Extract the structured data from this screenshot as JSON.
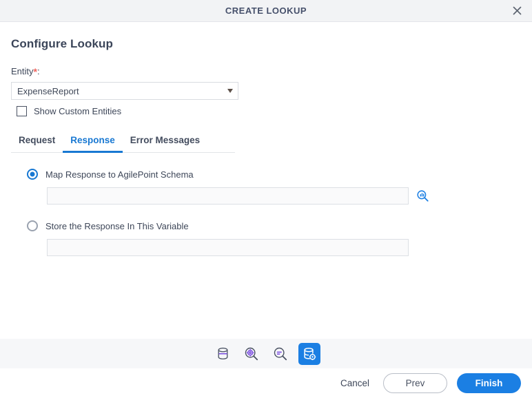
{
  "window": {
    "title": "CREATE LOOKUP",
    "close_icon": "close-icon"
  },
  "form": {
    "section_title": "Configure Lookup",
    "entity": {
      "label": "Entity",
      "required_marker": "*",
      "colon": ":",
      "selected_value": "ExpenseReport",
      "options": [
        "ExpenseReport"
      ],
      "arrow_icon": "chevron-down-icon"
    },
    "show_custom_entities": {
      "label": "Show Custom Entities",
      "checked": false
    }
  },
  "tabs": {
    "items": [
      {
        "label": "Request",
        "active": false
      },
      {
        "label": "Response",
        "active": true
      },
      {
        "label": "Error Messages",
        "active": false
      }
    ],
    "active_color": "#1878d2"
  },
  "response": {
    "option_map": {
      "label": "Map Response to AgilePoint Schema",
      "selected": true,
      "input_value": "",
      "input_placeholder": "",
      "lookup_icon": "magnifier-chart-icon"
    },
    "option_store": {
      "label": "Store the Response In This Variable",
      "selected": false,
      "input_value": "",
      "input_placeholder": ""
    }
  },
  "toolbar": {
    "items": [
      {
        "name": "database-icon",
        "label": "Data Source",
        "active": false
      },
      {
        "name": "magnifier-gear-icon",
        "label": "Configure Lookup",
        "active": false
      },
      {
        "name": "magnifier-list-icon",
        "label": "Lookup Results",
        "active": false
      },
      {
        "name": "database-gear-icon",
        "label": "Create Lookup",
        "active": true
      }
    ],
    "active_background": "#1b7fe3",
    "icon_accent": "#7b4fe0"
  },
  "footer": {
    "cancel_label": "Cancel",
    "prev_label": "Prev",
    "finish_label": "Finish",
    "primary_color": "#1b7fe3"
  }
}
